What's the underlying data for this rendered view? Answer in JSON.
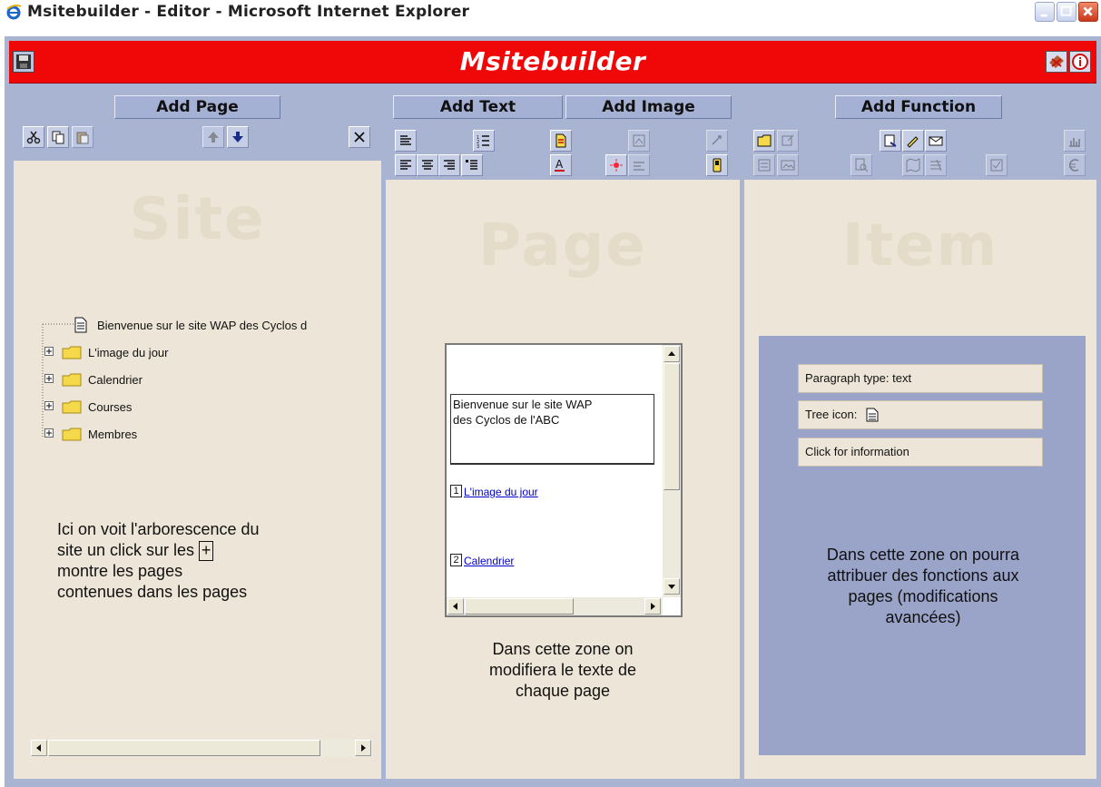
{
  "window": {
    "title": "Msitebuilder - Editor - Microsoft Internet Explorer"
  },
  "app": {
    "brand": "Msitebuilder"
  },
  "site_panel": {
    "add_button": "Add Page",
    "watermark": "Site",
    "tree": [
      {
        "type": "page",
        "label": "Bienvenue sur le site WAP des Cyclos d"
      },
      {
        "type": "folder",
        "label": "L'image du jour"
      },
      {
        "type": "folder",
        "label": "Calendrier"
      },
      {
        "type": "folder",
        "label": "Courses"
      },
      {
        "type": "folder",
        "label": "Membres"
      }
    ],
    "note_lines": [
      "Ici on voit l'arborescence du",
      "site un click sur les",
      "+",
      "montre les pages",
      "contenues dans les pages"
    ]
  },
  "page_panel": {
    "add_text_button": "Add Text",
    "add_image_button": "Add Image",
    "watermark": "Page",
    "preview": {
      "paragraph_line1": "Bienvenue sur le site WAP",
      "paragraph_line2": "des Cyclos de l'ABC",
      "links": [
        {
          "number": "1",
          "label": "L'image du jour"
        },
        {
          "number": "2",
          "label": "Calendrier"
        }
      ]
    },
    "note_lines": [
      "Dans cette zone on",
      "modifiera le texte de",
      "chaque page"
    ]
  },
  "item_panel": {
    "add_button": "Add Function",
    "watermark": "Item",
    "properties": {
      "paragraph_type": "Paragraph type: text",
      "tree_icon": "Tree icon:",
      "click_info": "Click for information"
    },
    "note_lines": [
      "Dans cette zone on pourra",
      "attribuer des fonctions aux",
      "pages (modifications",
      "avancées)"
    ]
  },
  "colors": {
    "header_red": "#f00808",
    "panel_blue": "#a9b4d3",
    "content_beige": "#ede6d8",
    "item_zone": "#9aa3c8"
  }
}
